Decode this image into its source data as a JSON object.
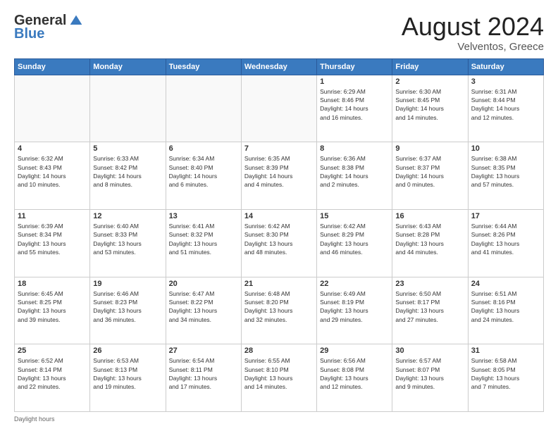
{
  "logo": {
    "general": "General",
    "blue": "Blue"
  },
  "title": "August 2024",
  "subtitle": "Velventos, Greece",
  "footer": "Daylight hours",
  "days": [
    "Sunday",
    "Monday",
    "Tuesday",
    "Wednesday",
    "Thursday",
    "Friday",
    "Saturday"
  ],
  "weeks": [
    [
      {
        "num": "",
        "info": ""
      },
      {
        "num": "",
        "info": ""
      },
      {
        "num": "",
        "info": ""
      },
      {
        "num": "",
        "info": ""
      },
      {
        "num": "1",
        "info": "Sunrise: 6:29 AM\nSunset: 8:46 PM\nDaylight: 14 hours\nand 16 minutes."
      },
      {
        "num": "2",
        "info": "Sunrise: 6:30 AM\nSunset: 8:45 PM\nDaylight: 14 hours\nand 14 minutes."
      },
      {
        "num": "3",
        "info": "Sunrise: 6:31 AM\nSunset: 8:44 PM\nDaylight: 14 hours\nand 12 minutes."
      }
    ],
    [
      {
        "num": "4",
        "info": "Sunrise: 6:32 AM\nSunset: 8:43 PM\nDaylight: 14 hours\nand 10 minutes."
      },
      {
        "num": "5",
        "info": "Sunrise: 6:33 AM\nSunset: 8:42 PM\nDaylight: 14 hours\nand 8 minutes."
      },
      {
        "num": "6",
        "info": "Sunrise: 6:34 AM\nSunset: 8:40 PM\nDaylight: 14 hours\nand 6 minutes."
      },
      {
        "num": "7",
        "info": "Sunrise: 6:35 AM\nSunset: 8:39 PM\nDaylight: 14 hours\nand 4 minutes."
      },
      {
        "num": "8",
        "info": "Sunrise: 6:36 AM\nSunset: 8:38 PM\nDaylight: 14 hours\nand 2 minutes."
      },
      {
        "num": "9",
        "info": "Sunrise: 6:37 AM\nSunset: 8:37 PM\nDaylight: 14 hours\nand 0 minutes."
      },
      {
        "num": "10",
        "info": "Sunrise: 6:38 AM\nSunset: 8:35 PM\nDaylight: 13 hours\nand 57 minutes."
      }
    ],
    [
      {
        "num": "11",
        "info": "Sunrise: 6:39 AM\nSunset: 8:34 PM\nDaylight: 13 hours\nand 55 minutes."
      },
      {
        "num": "12",
        "info": "Sunrise: 6:40 AM\nSunset: 8:33 PM\nDaylight: 13 hours\nand 53 minutes."
      },
      {
        "num": "13",
        "info": "Sunrise: 6:41 AM\nSunset: 8:32 PM\nDaylight: 13 hours\nand 51 minutes."
      },
      {
        "num": "14",
        "info": "Sunrise: 6:42 AM\nSunset: 8:30 PM\nDaylight: 13 hours\nand 48 minutes."
      },
      {
        "num": "15",
        "info": "Sunrise: 6:42 AM\nSunset: 8:29 PM\nDaylight: 13 hours\nand 46 minutes."
      },
      {
        "num": "16",
        "info": "Sunrise: 6:43 AM\nSunset: 8:28 PM\nDaylight: 13 hours\nand 44 minutes."
      },
      {
        "num": "17",
        "info": "Sunrise: 6:44 AM\nSunset: 8:26 PM\nDaylight: 13 hours\nand 41 minutes."
      }
    ],
    [
      {
        "num": "18",
        "info": "Sunrise: 6:45 AM\nSunset: 8:25 PM\nDaylight: 13 hours\nand 39 minutes."
      },
      {
        "num": "19",
        "info": "Sunrise: 6:46 AM\nSunset: 8:23 PM\nDaylight: 13 hours\nand 36 minutes."
      },
      {
        "num": "20",
        "info": "Sunrise: 6:47 AM\nSunset: 8:22 PM\nDaylight: 13 hours\nand 34 minutes."
      },
      {
        "num": "21",
        "info": "Sunrise: 6:48 AM\nSunset: 8:20 PM\nDaylight: 13 hours\nand 32 minutes."
      },
      {
        "num": "22",
        "info": "Sunrise: 6:49 AM\nSunset: 8:19 PM\nDaylight: 13 hours\nand 29 minutes."
      },
      {
        "num": "23",
        "info": "Sunrise: 6:50 AM\nSunset: 8:17 PM\nDaylight: 13 hours\nand 27 minutes."
      },
      {
        "num": "24",
        "info": "Sunrise: 6:51 AM\nSunset: 8:16 PM\nDaylight: 13 hours\nand 24 minutes."
      }
    ],
    [
      {
        "num": "25",
        "info": "Sunrise: 6:52 AM\nSunset: 8:14 PM\nDaylight: 13 hours\nand 22 minutes."
      },
      {
        "num": "26",
        "info": "Sunrise: 6:53 AM\nSunset: 8:13 PM\nDaylight: 13 hours\nand 19 minutes."
      },
      {
        "num": "27",
        "info": "Sunrise: 6:54 AM\nSunset: 8:11 PM\nDaylight: 13 hours\nand 17 minutes."
      },
      {
        "num": "28",
        "info": "Sunrise: 6:55 AM\nSunset: 8:10 PM\nDaylight: 13 hours\nand 14 minutes."
      },
      {
        "num": "29",
        "info": "Sunrise: 6:56 AM\nSunset: 8:08 PM\nDaylight: 13 hours\nand 12 minutes."
      },
      {
        "num": "30",
        "info": "Sunrise: 6:57 AM\nSunset: 8:07 PM\nDaylight: 13 hours\nand 9 minutes."
      },
      {
        "num": "31",
        "info": "Sunrise: 6:58 AM\nSunset: 8:05 PM\nDaylight: 13 hours\nand 7 minutes."
      }
    ]
  ]
}
